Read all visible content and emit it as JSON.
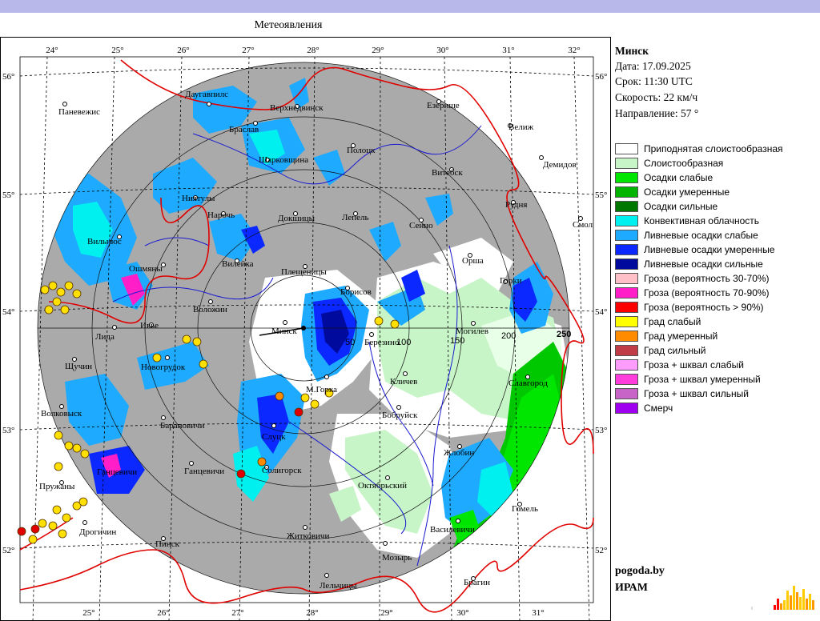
{
  "title": "Метеоявления",
  "station": {
    "name": "Минск",
    "date_label": "Дата:",
    "date": "17.09.2025",
    "time_label": "Срок:",
    "time": "11:30 UTC",
    "speed_label": "Скорость:",
    "speed": "22  км/ч",
    "direction_label": "Направление:",
    "direction": "57 °"
  },
  "legend": [
    {
      "label": "Приподнятая слоистообразная",
      "color": "#ffffff"
    },
    {
      "label": "Слоистообразная",
      "color": "#c8f5c8"
    },
    {
      "label": "Осадки слабые",
      "color": "#00e600"
    },
    {
      "label": "Осадки умеренные",
      "color": "#00b400"
    },
    {
      "label": "Осадки сильные",
      "color": "#007800"
    },
    {
      "label": "Конвективная облачность",
      "color": "#00f0f0"
    },
    {
      "label": "Ливневые осадки слабые",
      "color": "#1eaaff"
    },
    {
      "label": "Ливневые осадки умеренные",
      "color": "#0a28ff"
    },
    {
      "label": "Ливневые осадки сильные",
      "color": "#000a9c"
    },
    {
      "label": "Гроза (вероятность 30-70%)",
      "color": "#ffc0c8"
    },
    {
      "label": "Гроза (вероятность 70-90%)",
      "color": "#ff1ec8"
    },
    {
      "label": "Гроза (вероятность > 90%)",
      "color": "#ff0000"
    },
    {
      "label": "Град слабый",
      "color": "#ffff00"
    },
    {
      "label": "Град умеренный",
      "color": "#ff8c00"
    },
    {
      "label": "Град сильный",
      "color": "#c03c46"
    },
    {
      "label": "Гроза + шквал слабый",
      "color": "#ff9cff"
    },
    {
      "label": "Гроза + шквал умеренный",
      "color": "#ff3cdc"
    },
    {
      "label": "Гроза + шквал сильный",
      "color": "#c864c8"
    },
    {
      "label": "Смерч",
      "color": "#a000f0"
    }
  ],
  "footer": {
    "site": "pogoda.by",
    "org": "ИРАМ"
  },
  "map": {
    "lon_top": [
      "24°",
      "25°",
      "26°",
      "27°",
      "28°",
      "29°",
      "30°",
      "31°",
      "32°"
    ],
    "lon_bottom": [
      "25°",
      "26°",
      "27°",
      "28°",
      "29°",
      "30°",
      "31°"
    ],
    "lat_left": [
      "56°",
      "55°",
      "54°",
      "53°",
      "52°"
    ],
    "lat_right": [
      "56°",
      "55°",
      "54°",
      "53°",
      "52°"
    ],
    "range_labels": [
      "50",
      "100",
      "150",
      "200",
      "250"
    ],
    "cities": [
      {
        "name": "Паневежис"
      },
      {
        "name": "Даугавпилс"
      },
      {
        "name": "Верхнедвинск"
      },
      {
        "name": "Езерище"
      },
      {
        "name": "Велиж"
      },
      {
        "name": "Браслав"
      },
      {
        "name": "Полоцк"
      },
      {
        "name": "Шарковщина"
      },
      {
        "name": "Витебск"
      },
      {
        "name": "Демидов"
      },
      {
        "name": "Ниятулы"
      },
      {
        "name": "Нарочь"
      },
      {
        "name": "Докшицы"
      },
      {
        "name": "Лепель"
      },
      {
        "name": "Сенно"
      },
      {
        "name": "Рудня"
      },
      {
        "name": "Вильнюс"
      },
      {
        "name": "Смол"
      },
      {
        "name": "Ошмяны"
      },
      {
        "name": "Вилейка"
      },
      {
        "name": "Плещеницы"
      },
      {
        "name": "Орша"
      },
      {
        "name": "Борисов"
      },
      {
        "name": "Горки"
      },
      {
        "name": "Воложин"
      },
      {
        "name": "Ивье"
      },
      {
        "name": "Лида"
      },
      {
        "name": "Минск"
      },
      {
        "name": "Березино"
      },
      {
        "name": "Могилев"
      },
      {
        "name": "Щучин"
      },
      {
        "name": "Новогрудок"
      },
      {
        "name": "Кличев"
      },
      {
        "name": "М.Горка"
      },
      {
        "name": "Славгород"
      },
      {
        "name": "Волковыск"
      },
      {
        "name": "Барановичи"
      },
      {
        "name": "Бобруйск"
      },
      {
        "name": "Слуцк"
      },
      {
        "name": "Жлобин"
      },
      {
        "name": "Ганцевичи"
      },
      {
        "name": "Солигорск"
      },
      {
        "name": "Пружаны"
      },
      {
        "name": "Октябрьский"
      },
      {
        "name": "Гомель"
      },
      {
        "name": "Дрогичин"
      },
      {
        "name": "Пинск"
      },
      {
        "name": "Житковичи"
      },
      {
        "name": "Василевичи"
      },
      {
        "name": "Мозырь"
      },
      {
        "name": "Брагин"
      },
      {
        "name": "Лельчицы"
      },
      {
        "name": "Ганцевичи"
      }
    ]
  }
}
